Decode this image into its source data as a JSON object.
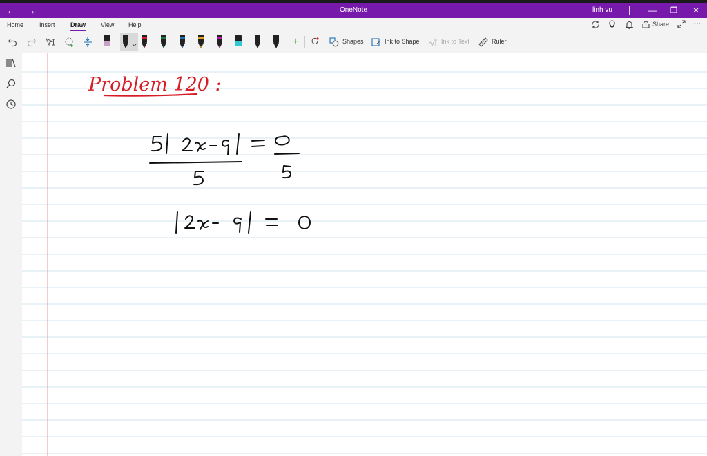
{
  "window": {
    "back_arrow": "←",
    "forward_arrow": "→",
    "app_title": "OneNote",
    "user_name": "linh vu",
    "minimize": "—",
    "restore": "❐",
    "close": "✕"
  },
  "ribbon": {
    "tabs": [
      {
        "label": "Home"
      },
      {
        "label": "Insert"
      },
      {
        "label": "Draw"
      },
      {
        "label": "View"
      },
      {
        "label": "Help"
      }
    ],
    "share_label": "Share",
    "more_label": "···"
  },
  "toolbar": {
    "shapes_label": "Shapes",
    "ink_to_shape_label": "Ink to Shape",
    "ink_to_text_label": "Ink to Text",
    "ruler_label": "Ruler",
    "add_pen": "+"
  },
  "pens": [
    {
      "color": "#c8a0c8",
      "kind": "highlighter"
    },
    {
      "color": "#222222",
      "kind": "pen",
      "selected": true
    },
    {
      "color": "#d61c24",
      "kind": "pen"
    },
    {
      "color": "#1a7a3a",
      "kind": "pen"
    },
    {
      "color": "#1e6fb8",
      "kind": "pen"
    },
    {
      "color": "#e0a21a",
      "kind": "pen"
    },
    {
      "color": "#b01ab0",
      "kind": "pen"
    },
    {
      "color": "#36c7d6",
      "kind": "highlighter"
    },
    {
      "color": "#222222",
      "kind": "pen"
    },
    {
      "color": "#222222",
      "kind": "pen"
    }
  ],
  "colors": {
    "accent": "#7719aa",
    "rule_line": "#cfe3ec",
    "margin_line": "#e89a9a",
    "ink_red": "#d61c24",
    "ink_black": "#111111"
  },
  "note": {
    "title": "Problem 120 :",
    "line1": "5|2x−9| / 5 = 0 / 5",
    "line2": "|2x−9| = 0"
  }
}
